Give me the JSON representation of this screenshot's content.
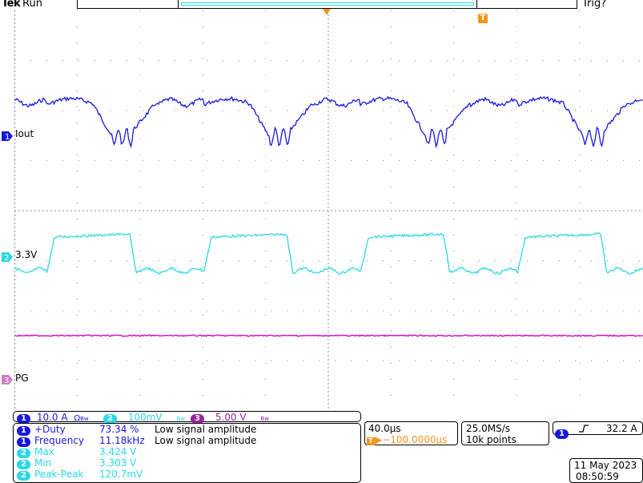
{
  "header": {
    "brand": "Tek",
    "run_status": "Run",
    "trigger_status": "Trig?"
  },
  "colors": {
    "ch1": "#1818d8",
    "ch2": "#2ad9e3",
    "ch3": "#cc16c0",
    "grid": "#8c8c8c",
    "marker_orange": "#f7941d",
    "ch3_pill": "#99239a"
  },
  "channels": {
    "ch1": {
      "num": "1",
      "label": "Iout",
      "scale": "10.0 A",
      "suffix": "Ω",
      "bw": "Bw"
    },
    "ch2": {
      "num": "2",
      "label": "3.3V",
      "scale": "100mV",
      "bw": "Bw"
    },
    "ch3": {
      "num": "3",
      "label": "PG",
      "scale": "5.00 V",
      "bw": "Bw"
    }
  },
  "measurements": [
    {
      "ch": "1",
      "name": "+Duty",
      "value": "73.34 %",
      "note": "Low signal amplitude"
    },
    {
      "ch": "1",
      "name": "Frequency",
      "value": "11.18kHz",
      "note": "Low signal amplitude"
    },
    {
      "ch": "2",
      "name": "Max",
      "value": "3.424 V",
      "note": ""
    },
    {
      "ch": "2",
      "name": "Min",
      "value": "3.303 V",
      "note": ""
    },
    {
      "ch": "2",
      "name": "Peak-Peak",
      "value": "120.7mV",
      "note": ""
    }
  ],
  "timebase": {
    "scale": "40.0µs",
    "delay": "▶−100.0000µs",
    "delay_prefix": "T",
    "sample_rate": "25.0MS/s",
    "record_length": "10k points"
  },
  "trigger": {
    "ch": "1",
    "slope_icon": "rising-edge-icon",
    "level": "32.2 A"
  },
  "datetime": {
    "date": "11 May 2023",
    "time": "08:50:59"
  },
  "markers": {
    "trigger_position": "T"
  }
}
